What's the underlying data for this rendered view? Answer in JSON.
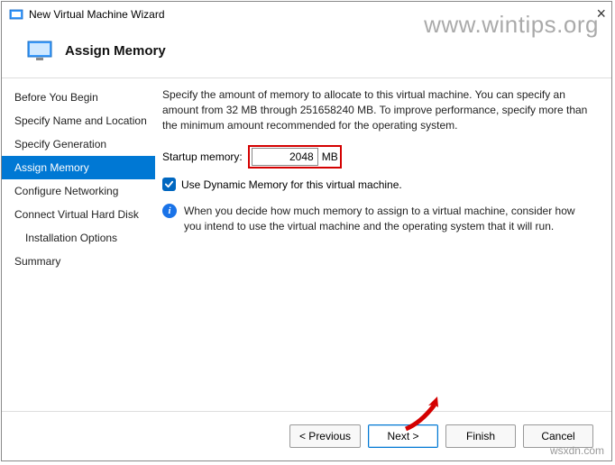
{
  "window": {
    "title": "New Virtual Machine Wizard",
    "close": "×"
  },
  "watermarks": {
    "top": "www.wintips.org",
    "bottom": "wsxdn.com"
  },
  "header": {
    "title": "Assign Memory"
  },
  "sidebar": {
    "items": [
      {
        "label": "Before You Begin",
        "active": false
      },
      {
        "label": "Specify Name and Location",
        "active": false
      },
      {
        "label": "Specify Generation",
        "active": false
      },
      {
        "label": "Assign Memory",
        "active": true
      },
      {
        "label": "Configure Networking",
        "active": false
      },
      {
        "label": "Connect Virtual Hard Disk",
        "active": false
      },
      {
        "label": "Installation Options",
        "active": false,
        "sub": true
      },
      {
        "label": "Summary",
        "active": false
      }
    ]
  },
  "main": {
    "description": "Specify the amount of memory to allocate to this virtual machine. You can specify an amount from 32 MB through 251658240 MB. To improve performance, specify more than the minimum amount recommended for the operating system.",
    "startup_label": "Startup memory:",
    "startup_value": "2048",
    "startup_unit": "MB",
    "dynamic_label": "Use Dynamic Memory for this virtual machine.",
    "dynamic_checked": true,
    "info": "When you decide how much memory to assign to a virtual machine, consider how you intend to use the virtual machine and the operating system that it will run."
  },
  "footer": {
    "previous": "< Previous",
    "next": "Next >",
    "finish": "Finish",
    "cancel": "Cancel"
  }
}
